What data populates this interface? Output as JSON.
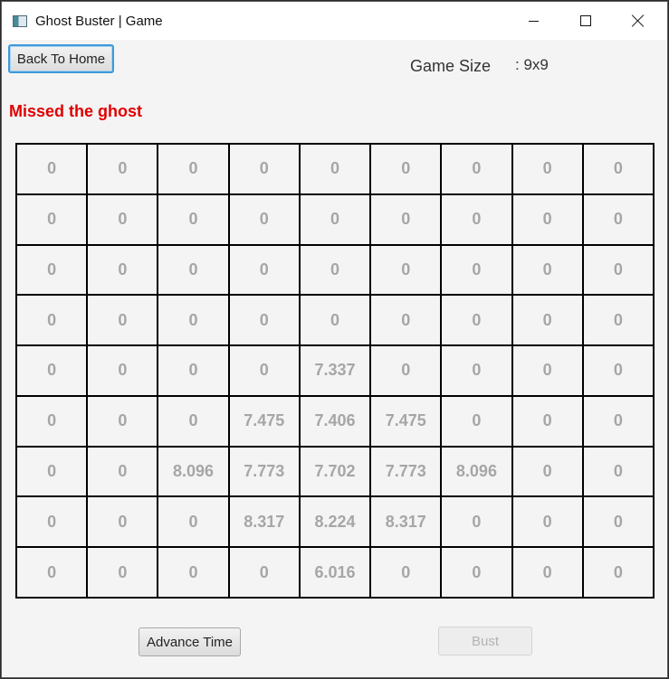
{
  "window": {
    "title": "Ghost Buster | Game"
  },
  "toolbar": {
    "back_label": "Back To Home",
    "game_size_label": "Game Size",
    "game_size_value": ": 9x9"
  },
  "status": {
    "message": "Missed the ghost",
    "color": "#e00000"
  },
  "grid": {
    "rows": [
      [
        "0",
        "0",
        "0",
        "0",
        "0",
        "0",
        "0",
        "0",
        "0"
      ],
      [
        "0",
        "0",
        "0",
        "0",
        "0",
        "0",
        "0",
        "0",
        "0"
      ],
      [
        "0",
        "0",
        "0",
        "0",
        "0",
        "0",
        "0",
        "0",
        "0"
      ],
      [
        "0",
        "0",
        "0",
        "0",
        "0",
        "0",
        "0",
        "0",
        "0"
      ],
      [
        "0",
        "0",
        "0",
        "0",
        "7.337",
        "0",
        "0",
        "0",
        "0"
      ],
      [
        "0",
        "0",
        "0",
        "7.475",
        "7.406",
        "7.475",
        "0",
        "0",
        "0"
      ],
      [
        "0",
        "0",
        "8.096",
        "7.773",
        "7.702",
        "7.773",
        "8.096",
        "0",
        "0"
      ],
      [
        "0",
        "0",
        "0",
        "8.317",
        "8.224",
        "8.317",
        "0",
        "0",
        "0"
      ],
      [
        "0",
        "0",
        "0",
        "0",
        "6.016",
        "0",
        "0",
        "0",
        "0"
      ]
    ]
  },
  "actions": {
    "advance_label": "Advance Time",
    "bust_label": "Bust",
    "bust_enabled": false
  },
  "icons": {
    "app": "app-window-icon",
    "minimize": "minimize-icon",
    "maximize": "maximize-icon",
    "close": "close-icon"
  }
}
